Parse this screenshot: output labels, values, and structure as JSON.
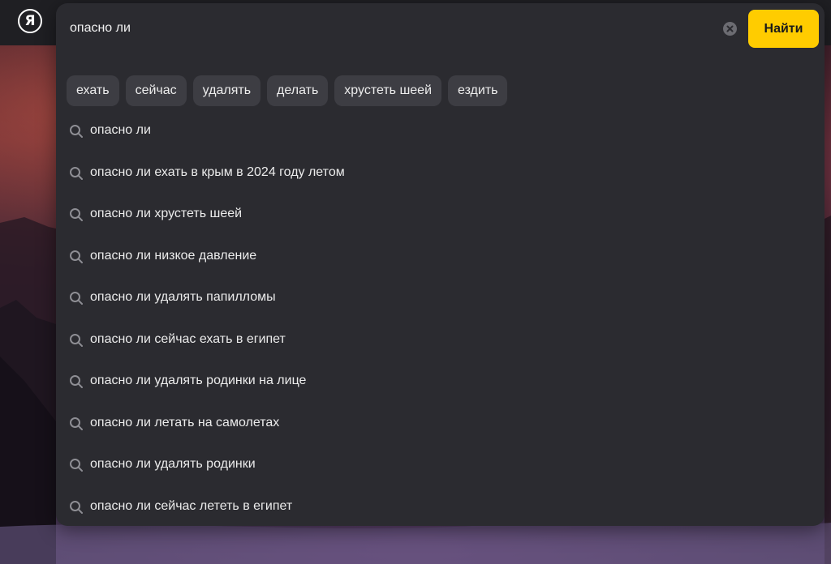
{
  "header": {
    "logo_letter": "Я"
  },
  "search": {
    "query": "опасно ли",
    "clear_icon": "clear-icon",
    "submit_label": "Найти",
    "accent_color": "#ffcc00"
  },
  "chips": [
    {
      "label": "ехать"
    },
    {
      "label": "сейчас"
    },
    {
      "label": "удалять"
    },
    {
      "label": "делать"
    },
    {
      "label": "хрустеть шеей"
    },
    {
      "label": "ездить"
    }
  ],
  "suggestions": [
    {
      "icon": "search-icon",
      "text": "опасно ли"
    },
    {
      "icon": "search-icon",
      "text": "опасно ли ехать в крым в 2024 году летом"
    },
    {
      "icon": "search-icon",
      "text": "опасно ли хрустеть шеей"
    },
    {
      "icon": "search-icon",
      "text": "опасно ли низкое давление"
    },
    {
      "icon": "search-icon",
      "text": "опасно ли удалять папилломы"
    },
    {
      "icon": "search-icon",
      "text": "опасно ли сейчас ехать в египет"
    },
    {
      "icon": "search-icon",
      "text": "опасно ли удалять родинки на лице"
    },
    {
      "icon": "search-icon",
      "text": "опасно ли летать на самолетах"
    },
    {
      "icon": "search-icon",
      "text": "опасно ли удалять родинки"
    },
    {
      "icon": "search-icon",
      "text": "опасно ли сейчас лететь в египет"
    }
  ]
}
